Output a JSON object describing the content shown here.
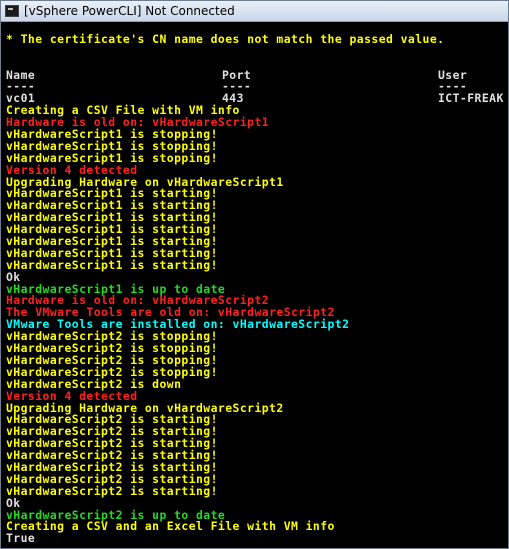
{
  "window": {
    "title": "[vSphere PowerCLI] Not Connected"
  },
  "console": {
    "warning": "* The certificate's CN name does not match the passed value.",
    "table": {
      "headers": [
        "Name",
        "Port",
        "User"
      ],
      "underline": [
        "----",
        "----",
        "----"
      ],
      "row": [
        "vc01",
        "443",
        "ICT-FREAK"
      ]
    },
    "lines": [
      {
        "text": "Creating a CSV File with VM info",
        "color": "#ffff00"
      },
      {
        "text": "Hardware is old on: vHardwareScript1",
        "color": "#ff2020"
      },
      {
        "text": "vHardwareScript1 is stopping!",
        "color": "#ffff00"
      },
      {
        "text": "vHardwareScript1 is stopping!",
        "color": "#ffff00"
      },
      {
        "text": "vHardwareScript1 is stopping!",
        "color": "#ffff00"
      },
      {
        "text": "Version 4 detected",
        "color": "#ff2020"
      },
      {
        "text": "Upgrading Hardware on vHardwareScript1",
        "color": "#ffff00"
      },
      {
        "text": "vHardwareScript1 is starting!",
        "color": "#ffff00"
      },
      {
        "text": "vHardwareScript1 is starting!",
        "color": "#ffff00"
      },
      {
        "text": "vHardwareScript1 is starting!",
        "color": "#ffff00"
      },
      {
        "text": "vHardwareScript1 is starting!",
        "color": "#ffff00"
      },
      {
        "text": "vHardwareScript1 is starting!",
        "color": "#ffff00"
      },
      {
        "text": "vHardwareScript1 is starting!",
        "color": "#ffff00"
      },
      {
        "text": "vHardwareScript1 is starting!",
        "color": "#ffff00"
      },
      {
        "text": "Ok",
        "color": "#e0e0e0"
      },
      {
        "text": "vHardwareScript1 is up to date",
        "color": "#22dd22"
      },
      {
        "text": "Hardware is old on: vHardwareScript2",
        "color": "#ff2020"
      },
      {
        "text": "The VMware Tools are old on: vHardwareScript2",
        "color": "#ff2020"
      },
      {
        "text": "VMware Tools are installed on: vHardwareScript2",
        "color": "#00ffff"
      },
      {
        "text": "vHardwareScript2 is stopping!",
        "color": "#ffff00"
      },
      {
        "text": "vHardwareScript2 is stopping!",
        "color": "#ffff00"
      },
      {
        "text": "vHardwareScript2 is stopping!",
        "color": "#ffff00"
      },
      {
        "text": "vHardwareScript2 is stopping!",
        "color": "#ffff00"
      },
      {
        "text": "vHardwareScript2 is down",
        "color": "#ffff00"
      },
      {
        "text": "Version 4 detected",
        "color": "#ff2020"
      },
      {
        "text": "Upgrading Hardware on vHardwareScript2",
        "color": "#ffff00"
      },
      {
        "text": "vHardwareScript2 is starting!",
        "color": "#ffff00"
      },
      {
        "text": "vHardwareScript2 is starting!",
        "color": "#ffff00"
      },
      {
        "text": "vHardwareScript2 is starting!",
        "color": "#ffff00"
      },
      {
        "text": "vHardwareScript2 is starting!",
        "color": "#ffff00"
      },
      {
        "text": "vHardwareScript2 is starting!",
        "color": "#ffff00"
      },
      {
        "text": "vHardwareScript2 is starting!",
        "color": "#ffff00"
      },
      {
        "text": "vHardwareScript2 is starting!",
        "color": "#ffff00"
      },
      {
        "text": "Ok",
        "color": "#e0e0e0"
      },
      {
        "text": "vHardwareScript2 is up to date",
        "color": "#22dd22"
      },
      {
        "text": "Creating a CSV and an Excel File with VM info",
        "color": "#ffff00"
      },
      {
        "text": "True",
        "color": "#e0e0e0"
      }
    ]
  }
}
